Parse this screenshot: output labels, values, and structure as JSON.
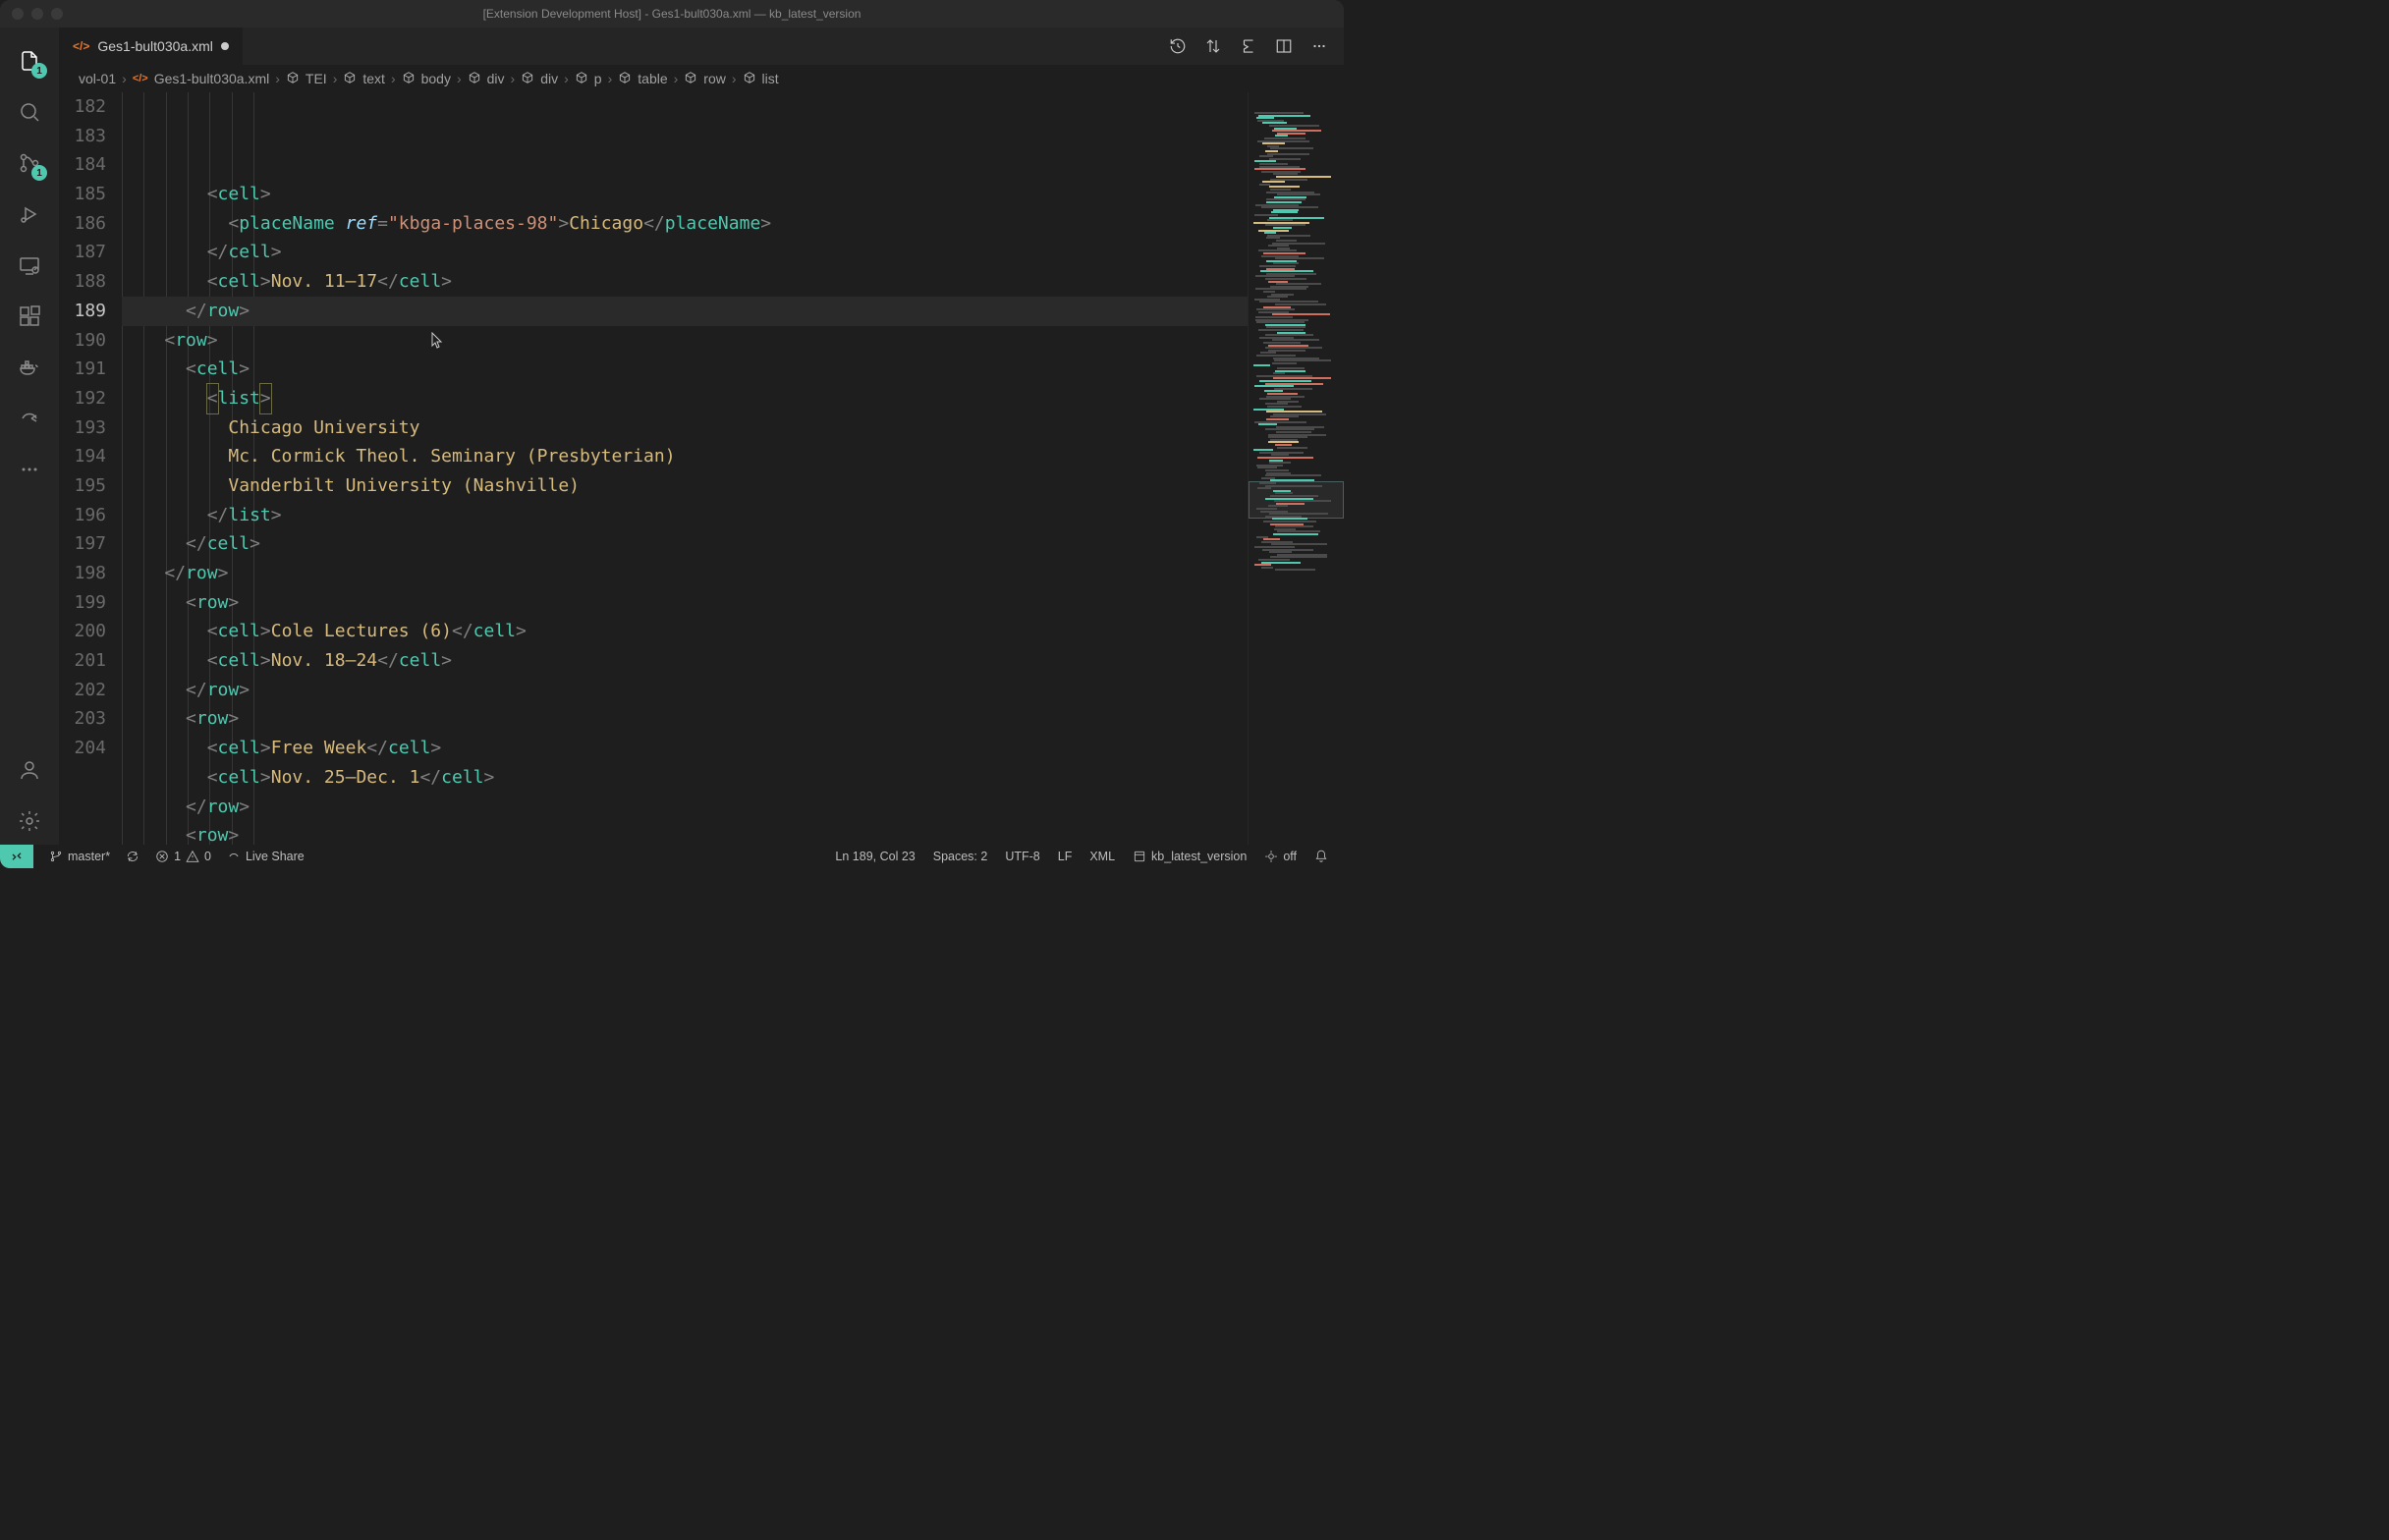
{
  "window_title": "[Extension Development Host] - Ges1-bult030a.xml — kb_latest_version",
  "tab": {
    "filename": "Ges1-bult030a.xml"
  },
  "activity": {
    "explorer_badge": "1",
    "scm_badge": "1"
  },
  "breadcrumbs": [
    "vol-01",
    "Ges1-bult030a.xml",
    "TEI",
    "text",
    "body",
    "div",
    "div",
    "p",
    "table",
    "row",
    "list"
  ],
  "gutter": [
    "182",
    "183",
    "184",
    "185",
    "186",
    "187",
    "188",
    "189",
    "190",
    "191",
    "192",
    "193",
    "194",
    "195",
    "196",
    "197",
    "198",
    "199",
    "200",
    "201",
    "202",
    "203",
    "204"
  ],
  "current_line_idx": 7,
  "code": {
    "l182": {
      "indent": 18,
      "open": "cell"
    },
    "l183": {
      "indent": 19,
      "tag": "placeName",
      "attr": "ref",
      "val": "\"kbga-places-98\"",
      "text": "Chicago"
    },
    "l184": {
      "indent": 18,
      "close": "cell"
    },
    "l185": {
      "indent": 18,
      "tag": "cell",
      "text": "Nov. 11–17"
    },
    "l186": {
      "indent": 17,
      "close": "row"
    },
    "l187": {
      "indent": 16,
      "open": "row"
    },
    "l188": {
      "indent": 17,
      "open": "cell"
    },
    "l189": {
      "indent": 18,
      "open": "list",
      "boxed": true
    },
    "l190": {
      "indent": 19,
      "text": "Chicago University"
    },
    "l191": {
      "indent": 19,
      "text": "Mc. Cormick Theol. Seminary (Presbyterian)"
    },
    "l192": {
      "indent": 19,
      "text": "Vanderbilt University (Nashville)"
    },
    "l193": {
      "indent": 18,
      "close": "list"
    },
    "l194": {
      "indent": 17,
      "close": "cell"
    },
    "l195": {
      "indent": 16,
      "close": "row"
    },
    "l196": {
      "indent": 17,
      "open": "row"
    },
    "l197": {
      "indent": 18,
      "tag": "cell",
      "text": "Cole Lectures (6)"
    },
    "l198": {
      "indent": 18,
      "tag": "cell",
      "text": "Nov. 18–24"
    },
    "l199": {
      "indent": 17,
      "close": "row"
    },
    "l200": {
      "indent": 17,
      "open": "row"
    },
    "l201": {
      "indent": 18,
      "tag": "cell",
      "text": "Free Week"
    },
    "l202": {
      "indent": 18,
      "tag": "cell",
      "text": "Nov. 25–Dec. 1"
    },
    "l203": {
      "indent": 17,
      "close": "row"
    },
    "l204": {
      "indent": 17,
      "open": "row"
    }
  },
  "statusbar": {
    "branch": "master*",
    "errors": "1",
    "warnings": "0",
    "liveshare": "Live Share",
    "position": "Ln 189, Col 23",
    "spaces": "Spaces: 2",
    "encoding": "UTF-8",
    "eol": "LF",
    "language": "XML",
    "workspace": "kb_latest_version",
    "ports": "off"
  }
}
